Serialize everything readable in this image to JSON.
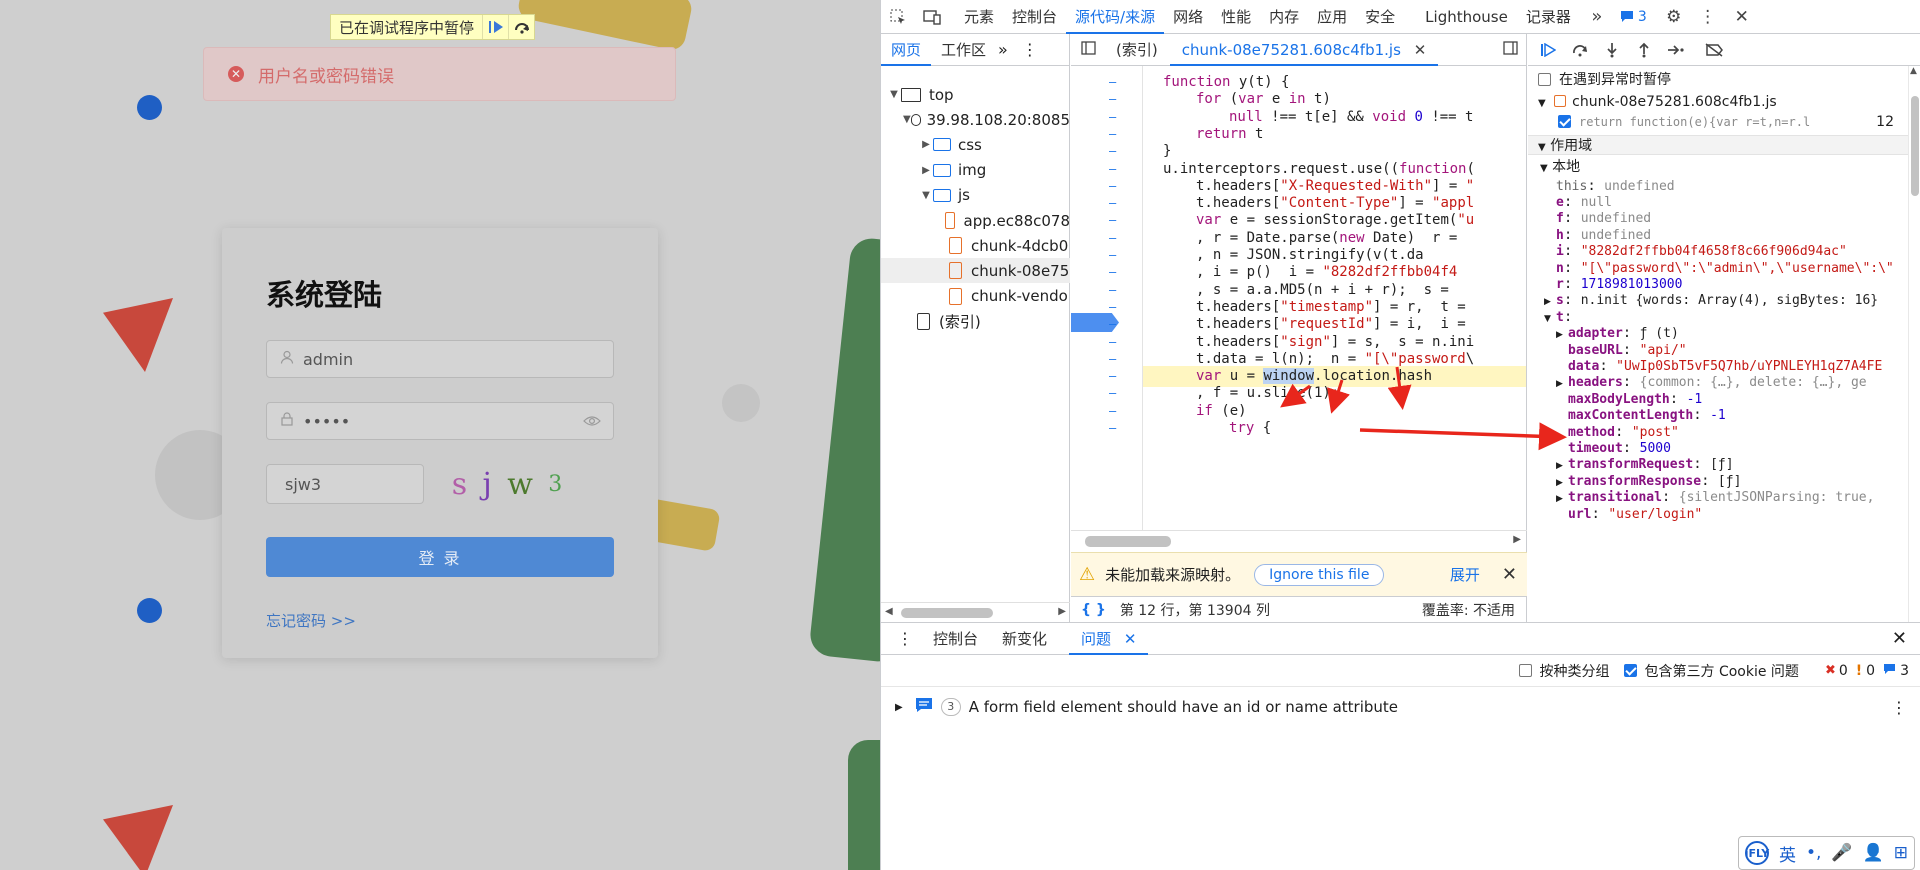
{
  "page": {
    "debug_banner": "已在调试程序中暂停",
    "error_message": "用户名或密码错误",
    "login": {
      "title": "系统登陆",
      "username": "admin",
      "password": "•••••",
      "captcha_input": "sjw3",
      "captcha_chars": [
        "s",
        "j",
        "w",
        "3"
      ],
      "captcha_colors": [
        "#b25fa8",
        "#7a3fb0",
        "#4d7a2e",
        "#4fa04f"
      ],
      "login_button": "登 录",
      "forgot_link": "忘记密码 >>"
    }
  },
  "devtools": {
    "main_tabs": [
      "元素",
      "控制台",
      "源代码/来源",
      "网络",
      "性能",
      "内存",
      "应用",
      "安全",
      "Lighthouse",
      "记录器"
    ],
    "active_main_tab": "源代码/来源",
    "messages_count": "3",
    "navigator": {
      "tabs": [
        "网页",
        "工作区"
      ],
      "tree": [
        {
          "label": "top",
          "depth": 0,
          "icon": "monitor",
          "arrow": "▼"
        },
        {
          "label": "39.98.108.20:8085",
          "depth": 1,
          "icon": "cloud",
          "arrow": "▼"
        },
        {
          "label": "css",
          "depth": 2,
          "icon": "folder",
          "arrow": "▶"
        },
        {
          "label": "img",
          "depth": 2,
          "icon": "folder",
          "arrow": "▶"
        },
        {
          "label": "js",
          "depth": 2,
          "icon": "folder",
          "arrow": "▼"
        },
        {
          "label": "app.ec88c078",
          "depth": 3,
          "icon": "file",
          "arrow": ""
        },
        {
          "label": "chunk-4dcb0",
          "depth": 3,
          "icon": "file",
          "arrow": ""
        },
        {
          "label": "chunk-08e75",
          "depth": 3,
          "icon": "file",
          "arrow": "",
          "selected": true
        },
        {
          "label": "chunk-vendo",
          "depth": 3,
          "icon": "file",
          "arrow": ""
        },
        {
          "label": "(索引)",
          "depth": 1,
          "icon": "file-plain",
          "arrow": ""
        }
      ]
    },
    "editor": {
      "tabs": [
        "(索引)",
        "chunk-08e75281.608c4fb1.js"
      ],
      "active_tab": "chunk-08e75281.608c4fb1.js",
      "code_lines": [
        {
          "html": "function y(t) {",
          "indent": 0
        },
        {
          "html": "for (var e in t)",
          "indent": 1
        },
        {
          "html": "null !== t[e] && void 0 !== t",
          "indent": 2
        },
        {
          "html": "return t",
          "indent": 1
        },
        {
          "html": "}",
          "indent": 0
        },
        {
          "html": "u.interceptors.request.use((function(",
          "indent": 0
        },
        {
          "html": "t.headers[\"X-Requested-With\"] = \"",
          "indent": 1
        },
        {
          "html": "t.headers[\"Content-Type\"] = \"appl",
          "indent": 1
        },
        {
          "html": "var e = sessionStorage.getItem(\"u",
          "indent": 1
        },
        {
          "html": ", r = Date.parse(new Date)  r =",
          "indent": 1
        },
        {
          "html": ", n = JSON.stringify(v(t.da",
          "indent": 1
        },
        {
          "html": ", i = p()  i = \"8282df2ffbb04f4",
          "indent": 1
        },
        {
          "html": ", s = a.a.MD5(n + i + r);  s =",
          "indent": 1
        },
        {
          "html": "t.headers[\"timestamp\"] = r,  t =",
          "indent": 1
        },
        {
          "html": "t.headers[\"requestId\"] = i,  i =",
          "indent": 1
        },
        {
          "html": "t.headers[\"sign\"] = s,  s = n.ini",
          "indent": 1
        },
        {
          "html": "t.data = l(n);  n = \"[\\\"password\\",
          "indent": 1
        },
        {
          "html": "var u = window.location.hash",
          "indent": 1,
          "highlight": true
        },
        {
          "html": ", f = u.slice(1);",
          "indent": 1
        },
        {
          "html": "if (e)",
          "indent": 1
        },
        {
          "html": "try {",
          "indent": 2
        }
      ],
      "warning": "未能加载来源映射。",
      "ignore_button": "Ignore this file",
      "expand_link": "展开",
      "status_position": "第 12 行，第 13904 列",
      "coverage": "覆盖率: 不适用"
    },
    "scope": {
      "pause_on_exceptions": "在遇到异常时暂停",
      "breakpoint_file": "chunk-08e75281.608c4fb1.js",
      "breakpoint_code": "return function(e){var r=t,n=r.l",
      "breakpoint_line": "12",
      "scope_header": "作用域",
      "local_header": "本地",
      "vars": [
        {
          "k": "this",
          "v": "undefined",
          "t": "gray",
          "dim": true
        },
        {
          "k": "e",
          "v": "null",
          "t": "gray"
        },
        {
          "k": "f",
          "v": "undefined",
          "t": "gray"
        },
        {
          "k": "h",
          "v": "undefined",
          "t": "gray"
        },
        {
          "k": "i",
          "v": "\"8282df2ffbb04f4658f8c66f906d94ac\"",
          "t": "str"
        },
        {
          "k": "n",
          "v": "\"[\\\"password\\\":\\\"admin\\\",\\\"username\\\":\\\"",
          "t": "str"
        },
        {
          "k": "r",
          "v": "1718981013000",
          "t": "num"
        },
        {
          "k": "s",
          "v": "n.init  {words: Array(4), sigBytes: 16}",
          "t": "obj",
          "arrow": "▶"
        },
        {
          "k": "t",
          "v": "",
          "t": "obj",
          "arrow": "▼"
        }
      ],
      "t_props": [
        {
          "k": "adapter",
          "v": "ƒ (t)",
          "t": "obj",
          "arrow": "▶"
        },
        {
          "k": "baseURL",
          "v": "\"api/\"",
          "t": "str"
        },
        {
          "k": "data",
          "v": "\"UwIp0SbT5vF5Q7hb/uYPNLEYH1qZ7A4FE",
          "t": "str"
        },
        {
          "k": "headers",
          "v": "{common: {…}, delete: {…}, ge",
          "t": "gray",
          "arrow": "▶"
        },
        {
          "k": "maxBodyLength",
          "v": "-1",
          "t": "num"
        },
        {
          "k": "maxContentLength",
          "v": "-1",
          "t": "num"
        },
        {
          "k": "method",
          "v": "\"post\"",
          "t": "str"
        },
        {
          "k": "timeout",
          "v": "5000",
          "t": "num"
        },
        {
          "k": "transformRequest",
          "v": "[ƒ]",
          "t": "obj",
          "arrow": "▶"
        },
        {
          "k": "transformResponse",
          "v": "[ƒ]",
          "t": "obj",
          "arrow": "▶"
        },
        {
          "k": "transitional",
          "v": "{silentJSONParsing: true,",
          "t": "gray",
          "arrow": "▶"
        },
        {
          "k": "url",
          "v": "\"user/login\"",
          "t": "str"
        }
      ]
    },
    "drawer": {
      "tabs": [
        "控制台",
        "新变化",
        "问题"
      ],
      "active_tab": "问题",
      "group_by_category": "按种类分组",
      "include_third_party": "包含第三方 Cookie 问题",
      "error_count": "0",
      "warning_count": "0",
      "info_count": "3",
      "issue_count": "3",
      "issue_text": "A form field element should have an id or name attribute"
    },
    "ifly_toolbar": [
      "iFLY",
      "英",
      "•,",
      "🎤",
      "👤",
      "⊞"
    ]
  },
  "colors": {
    "accent": "#1a73e8",
    "arrow": "#e8261c",
    "error": "#d65b5b",
    "login_button": "#4f89d4"
  }
}
